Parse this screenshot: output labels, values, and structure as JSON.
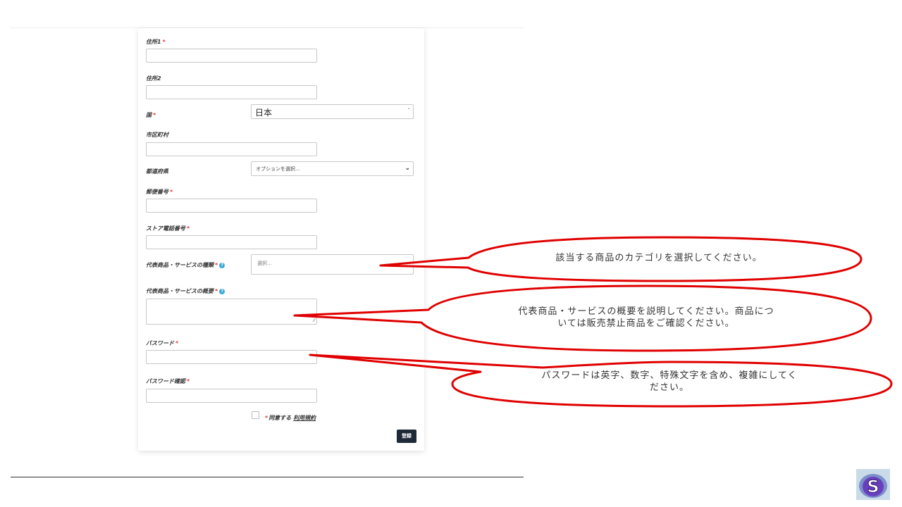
{
  "form": {
    "address1_label": "住所1",
    "address2_label": "住所2",
    "country_label": "国",
    "country_value": "日本",
    "city_label": "市区町村",
    "prefecture_label": "都道府県",
    "prefecture_placeholder": "オプションを選択…",
    "postal_label": "郵便番号",
    "phone_label": "ストア電話番号",
    "category_label": "代表商品・サービスの種類",
    "category_placeholder": "選択…",
    "summary_label": "代表商品・サービスの概要",
    "password_label": "パスワード",
    "password_confirm_label": "パスワード確認",
    "required_mark": "*",
    "agree_text": "同意する",
    "terms_link": "利用規約",
    "submit_label": "登録"
  },
  "callouts": {
    "category_hint": "該当する商品のカテゴリを選択してください。",
    "summary_hint_line1": "代表商品・サービスの概要を説明してください。商品につ",
    "summary_hint_line2": "いては販売禁止商品をご確認ください。",
    "password_hint_line1": "パスワードは英字、数字、特殊文字を含め、複雑にしてく",
    "password_hint_line2": "ださい。",
    "outline_color": "#e00000"
  },
  "logo": {
    "letter": "S",
    "icon": "s-logo-icon"
  }
}
